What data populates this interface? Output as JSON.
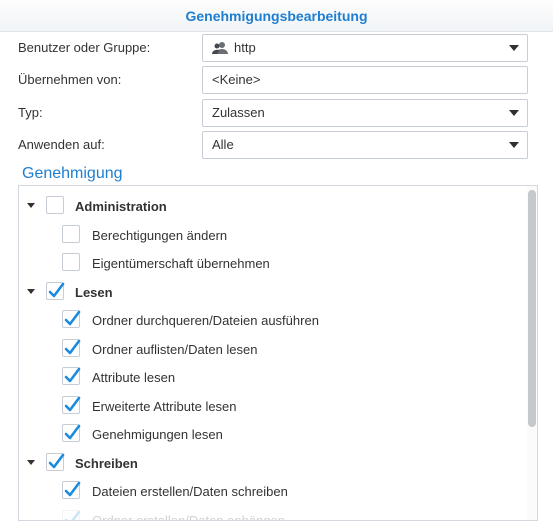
{
  "dialog": {
    "title": "Genehmigungsbearbeitung"
  },
  "form": {
    "user_or_group": {
      "label": "Benutzer oder Gruppe:",
      "value": "http",
      "icon": "user-group-icon"
    },
    "inherit_from": {
      "label": "Übernehmen von:",
      "value": "<Keine>"
    },
    "type": {
      "label": "Typ:",
      "value": "Zulassen"
    },
    "apply_to": {
      "label": "Anwenden auf:",
      "value": "Alle"
    }
  },
  "permissions": {
    "title": "Genehmigung",
    "groups": [
      {
        "label": "Administration",
        "checked": false,
        "expanded": true,
        "items": [
          {
            "label": "Berechtigungen ändern",
            "checked": false
          },
          {
            "label": "Eigentümerschaft übernehmen",
            "checked": false
          }
        ]
      },
      {
        "label": "Lesen",
        "checked": true,
        "expanded": true,
        "items": [
          {
            "label": "Ordner durchqueren/Dateien ausführen",
            "checked": true
          },
          {
            "label": "Ordner auflisten/Daten lesen",
            "checked": true
          },
          {
            "label": "Attribute lesen",
            "checked": true
          },
          {
            "label": "Erweiterte Attribute lesen",
            "checked": true
          },
          {
            "label": "Genehmigungen lesen",
            "checked": true
          }
        ]
      },
      {
        "label": "Schreiben",
        "checked": true,
        "expanded": true,
        "items": [
          {
            "label": "Dateien erstellen/Daten schreiben",
            "checked": true
          },
          {
            "label": "Ordner erstellen/Daten anhängen",
            "checked": true
          }
        ]
      }
    ]
  },
  "colors": {
    "accent": "#1e7ed0",
    "checkmark": "#1a8be0",
    "text": "#333333",
    "border": "#c8ced5"
  }
}
